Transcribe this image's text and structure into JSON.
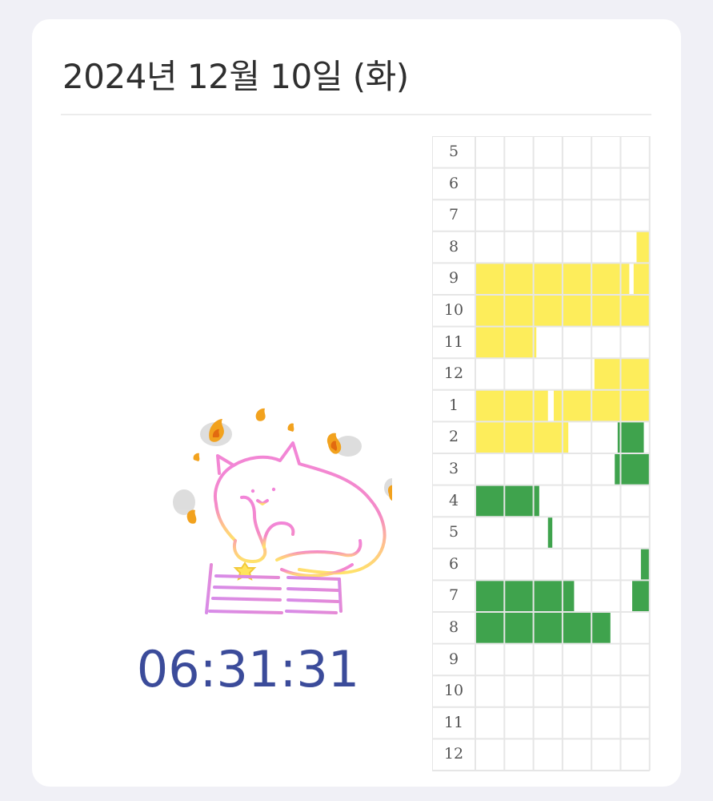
{
  "header": {
    "date_title": "2024년 12월 10일 (화)"
  },
  "timer": {
    "value": "06:31:31"
  },
  "mascot": {
    "icon": "studying-cat-with-fire-icon"
  },
  "colors": {
    "study": "#fded5b",
    "other": "#3fa34d",
    "grid_line": "#e6e6e6",
    "timer": "#3b4b9a"
  },
  "time_grid": {
    "columns_per_hour": 6,
    "hours": [
      "5",
      "6",
      "7",
      "8",
      "9",
      "10",
      "11",
      "12",
      "1",
      "2",
      "3",
      "4",
      "5",
      "6",
      "7",
      "8",
      "9",
      "10",
      "11",
      "12"
    ],
    "blocks": [
      {
        "row": 3,
        "start": 5.55,
        "end": 6,
        "category": "study"
      },
      {
        "row": 4,
        "start": 0,
        "end": 5.3,
        "category": "study"
      },
      {
        "row": 4,
        "start": 5.45,
        "end": 6,
        "category": "study"
      },
      {
        "row": 5,
        "start": 0,
        "end": 6,
        "category": "study"
      },
      {
        "row": 6,
        "start": 0,
        "end": 2.1,
        "category": "study"
      },
      {
        "row": 7,
        "start": 4.1,
        "end": 6,
        "category": "study"
      },
      {
        "row": 8,
        "start": 0,
        "end": 2.5,
        "category": "study"
      },
      {
        "row": 8,
        "start": 2.7,
        "end": 6,
        "category": "study"
      },
      {
        "row": 9,
        "start": 0,
        "end": 3.2,
        "category": "study"
      },
      {
        "row": 9,
        "start": 4.9,
        "end": 5.8,
        "category": "other"
      },
      {
        "row": 10,
        "start": 4.8,
        "end": 6,
        "category": "other"
      },
      {
        "row": 11,
        "start": 0,
        "end": 2.2,
        "category": "other"
      },
      {
        "row": 12,
        "start": 2.5,
        "end": 2.65,
        "category": "other"
      },
      {
        "row": 13,
        "start": 5.7,
        "end": 6,
        "category": "other"
      },
      {
        "row": 14,
        "start": 0,
        "end": 3.4,
        "category": "other"
      },
      {
        "row": 14,
        "start": 5.4,
        "end": 6,
        "category": "other"
      },
      {
        "row": 15,
        "start": 0,
        "end": 4.65,
        "category": "other"
      }
    ]
  }
}
